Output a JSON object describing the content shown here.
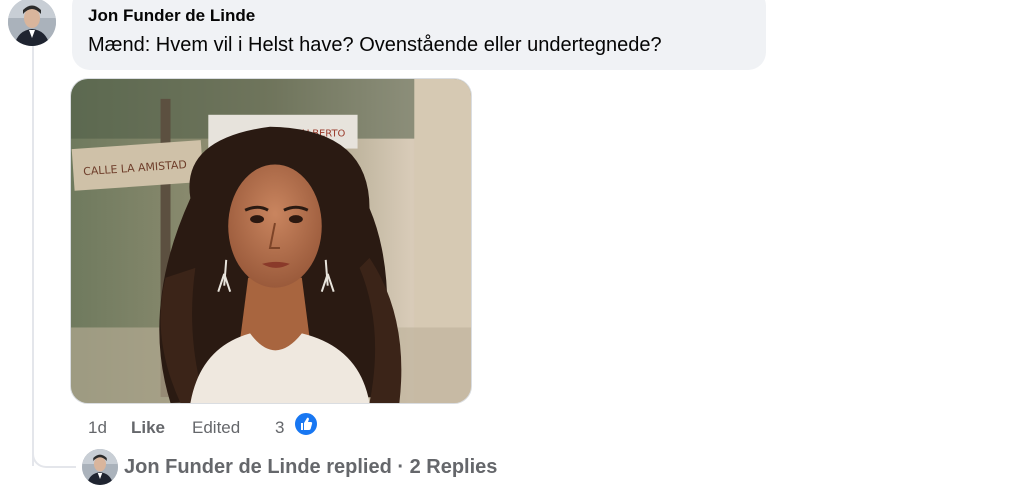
{
  "comment": {
    "author": "Jon Funder de Linde",
    "text": "Mænd: Hvem vil i Helst have? Ovenstående eller undertegnede?",
    "avatar_icon": "profile-photo-icon"
  },
  "image": {
    "alt": "photo-attachment",
    "sign_left": "CALLE LA AMISTAD",
    "sign_right": "ALBERTO"
  },
  "actions": {
    "time": "1d",
    "like_label": "Like",
    "edited_label": "Edited",
    "reaction_count": "3",
    "reaction_icon": "thumbs-up-icon"
  },
  "replies": {
    "label": "Jon Funder de Linde replied · 2 Replies"
  },
  "colors": {
    "bubble": "#f0f2f5",
    "secondary_text": "#65676b",
    "like_blue": "#1877f2"
  }
}
